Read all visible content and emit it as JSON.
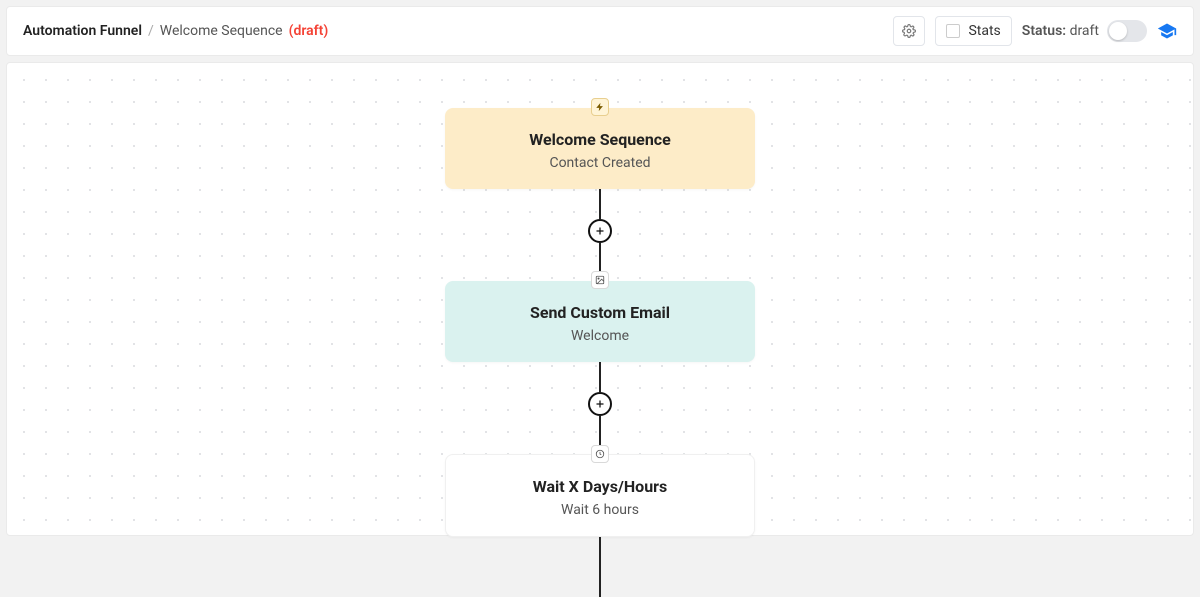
{
  "breadcrumb": {
    "root": "Automation Funnel",
    "name": "Welcome Sequence",
    "draft_label": "(draft)"
  },
  "toolbar": {
    "stats_label": "Stats",
    "status_prefix": "Status: ",
    "status_value": "draft"
  },
  "flow": {
    "trigger": {
      "title": "Welcome Sequence",
      "subtitle": "Contact Created",
      "badge_icon": "bolt-icon"
    },
    "actions": [
      {
        "title": "Send Custom Email",
        "subtitle": "Welcome",
        "style": "email",
        "badge_icon": "image-icon"
      },
      {
        "title": "Wait X Days/Hours",
        "subtitle": "Wait 6 hours",
        "style": "wait",
        "badge_icon": "clock-icon"
      }
    ]
  }
}
